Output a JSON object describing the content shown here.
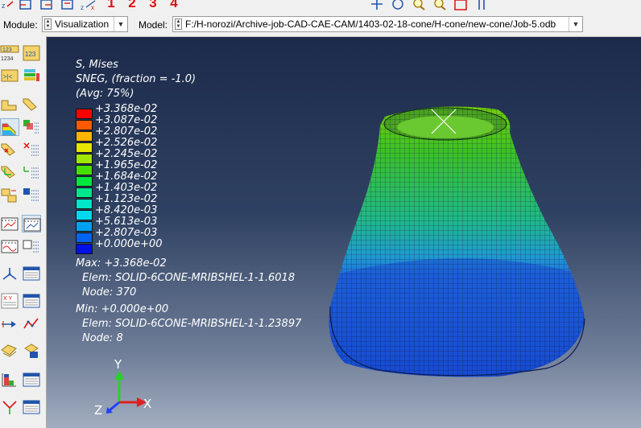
{
  "toolbar_top": {
    "numbers": [
      "1",
      "2",
      "3",
      "4"
    ]
  },
  "context_bar": {
    "module_label": "Module:",
    "module_value": "Visualization",
    "model_label": "Model:",
    "model_value": "F:/H-norozi/Archive-job-CAD-CAE-CAM/1403-02-18-cone/H-cone/new-cone/Job-5.odb"
  },
  "toolbox": {
    "icons": [
      "plot-undeformed-icon",
      "plot-deformed-icon",
      "contour-plot-icon",
      "symbol-plot-icon",
      "material-orientation-icon",
      "animate-icon",
      "xy-data-icon",
      "path-icon",
      "display-group-icon",
      "viewcut-icon"
    ]
  },
  "legend": {
    "title_lines": [
      "S, Mises",
      "SNEG, (fraction = -1.0)",
      "(Avg: 75%)"
    ],
    "entries": [
      {
        "value": "+3.368e-02",
        "color": "#ff0000"
      },
      {
        "value": "+3.087e-02",
        "color": "#ff5a00"
      },
      {
        "value": "+2.807e-02",
        "color": "#ffb400"
      },
      {
        "value": "+2.526e-02",
        "color": "#e6e600"
      },
      {
        "value": "+2.245e-02",
        "color": "#9fe600"
      },
      {
        "value": "+1.965e-02",
        "color": "#45e000"
      },
      {
        "value": "+1.684e-02",
        "color": "#00e640"
      },
      {
        "value": "+1.403e-02",
        "color": "#00e68c"
      },
      {
        "value": "+1.123e-02",
        "color": "#00e6c8"
      },
      {
        "value": "+8.420e-03",
        "color": "#00d8f0"
      },
      {
        "value": "+5.613e-03",
        "color": "#00a0f0"
      },
      {
        "value": "+2.807e-03",
        "color": "#0064f0"
      },
      {
        "value": "+0.000e+00",
        "color": "#0010e6"
      }
    ],
    "max_line": "Max: +3.368e-02",
    "max_elem": "Elem: SOLID-6CONE-MRIBSHEL-1-1.6018",
    "max_node": "Node: 370",
    "min_line": "Min: +0.000e+00",
    "min_elem": "Elem: SOLID-6CONE-MRIBSHEL-1-1.23897",
    "min_node": "Node: 8"
  },
  "triad": {
    "x": "X",
    "y": "Y",
    "z": "Z"
  },
  "colors": {
    "viewport_top": "#1c2a4b",
    "viewport_bottom": "#a2adbf",
    "mesh_blue": "#1a5ad0",
    "mesh_green": "#3cb93c"
  }
}
